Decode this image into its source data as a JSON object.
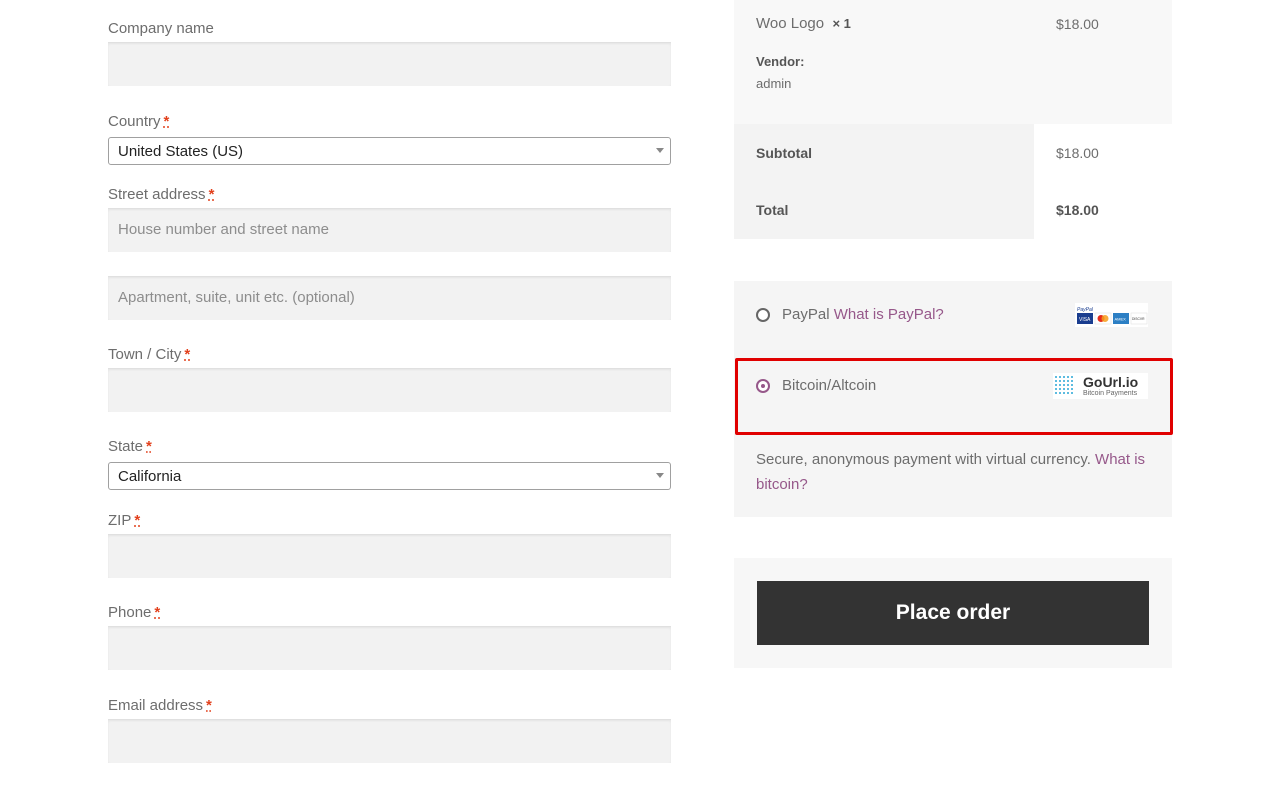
{
  "form": {
    "company": {
      "label": "Company name"
    },
    "country": {
      "label": "Country",
      "value": "United States (US)"
    },
    "street": {
      "label": "Street address",
      "placeholder1": "House number and street name",
      "placeholder2": "Apartment, suite, unit etc. (optional)"
    },
    "city": {
      "label": "Town / City"
    },
    "state": {
      "label": "State",
      "value": "California"
    },
    "zip": {
      "label": "ZIP"
    },
    "phone": {
      "label": "Phone"
    },
    "email": {
      "label": "Email address"
    },
    "required_mark": "*"
  },
  "order": {
    "item_name": "Woo Logo",
    "item_qty": "× 1",
    "item_price": "$18.00",
    "vendor_label": "Vendor:",
    "vendor_value": "admin",
    "subtotal_label": "Subtotal",
    "subtotal_value": "$18.00",
    "total_label": "Total",
    "total_value": "$18.00"
  },
  "payment": {
    "paypal_label": "PayPal",
    "paypal_link": "What is PayPal?",
    "paypal_logo_text": "PayPal VISA MC AMEX DISCOVER",
    "bitcoin_label": "Bitcoin/Altcoin",
    "gourl_logo_main": "GoUrl.io",
    "gourl_logo_sub": "Bitcoin Payments",
    "description": "Secure, anonymous payment with virtual currency.",
    "description_link_1": "What is",
    "description_link_2": "bitcoin?",
    "place_order": "Place order",
    "colors": {
      "accent": "#96588a",
      "highlight": "#e00000",
      "button": "#333333"
    }
  }
}
